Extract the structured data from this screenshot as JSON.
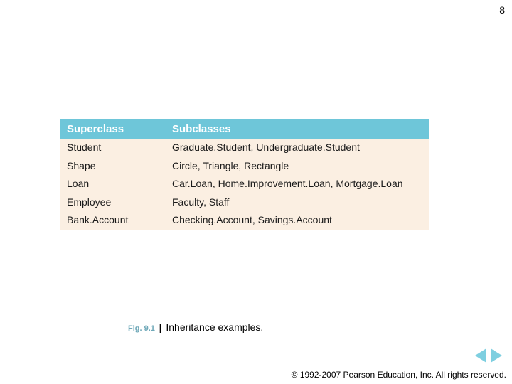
{
  "page_number": "8",
  "table": {
    "headers": {
      "superclass": "Superclass",
      "subclasses": "Subclasses"
    },
    "rows": [
      {
        "superclass": "Student",
        "subclasses": [
          "Graduate.Student",
          "Undergraduate.Student"
        ]
      },
      {
        "superclass": "Shape",
        "subclasses": [
          "Circle",
          "Triangle",
          "Rectangle"
        ]
      },
      {
        "superclass": "Loan",
        "subclasses": [
          "Car.Loan",
          "Home.Improvement.Loan",
          "Mortgage.Loan"
        ]
      },
      {
        "superclass": "Employee",
        "subclasses": [
          "Faculty",
          "Staff"
        ]
      },
      {
        "superclass": "Bank.Account",
        "subclasses": [
          "Checking.Account",
          "Savings.Account"
        ]
      }
    ]
  },
  "caption": {
    "label": "Fig. 9.1",
    "separator": "|",
    "title": "Inheritance examples."
  },
  "copyright": "© 1992-2007 Pearson Education, Inc.  All rights reserved."
}
